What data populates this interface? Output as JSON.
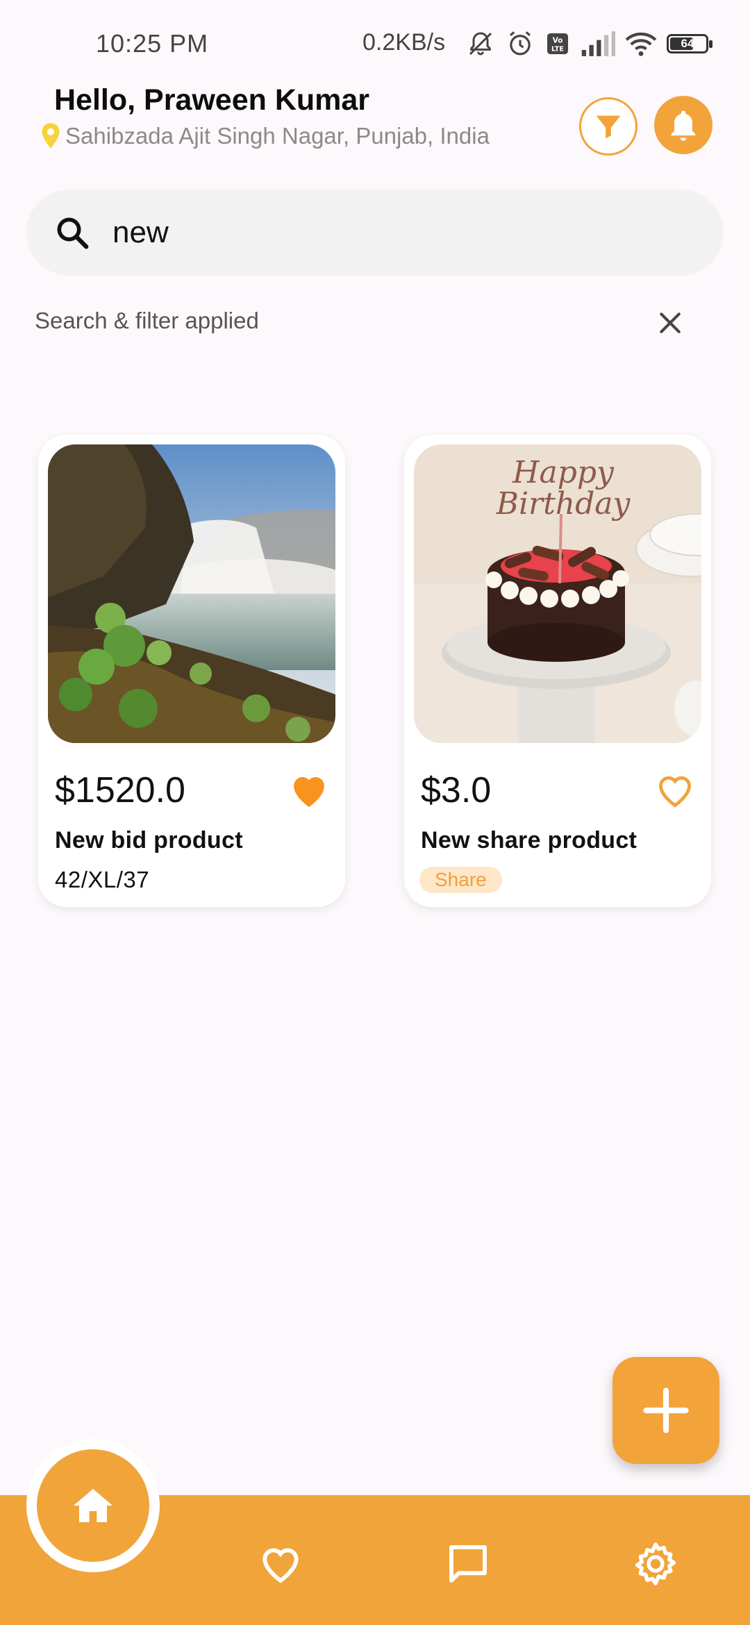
{
  "status_bar": {
    "time": "10:25 PM",
    "network_speed": "0.2KB/s",
    "battery_level": "64",
    "icons": [
      "mute-icon",
      "alarm-icon",
      "volte-icon",
      "signal-icon",
      "wifi-icon",
      "battery-icon"
    ]
  },
  "header": {
    "greeting": "Hello, Praween Kumar",
    "location": "Sahibzada Ajit Singh Nagar, Punjab, India",
    "filter_icon": "filter-icon",
    "notification_icon": "bell-icon"
  },
  "search": {
    "value": "new",
    "filter_status": "Search & filter applied",
    "clear_icon": "close-icon"
  },
  "products": [
    {
      "price": "$1520.0",
      "name": "New bid product",
      "meta": "42/XL/37",
      "favorited": true,
      "image": "waterfall landscape photo"
    },
    {
      "price": "$3.0",
      "name": "New share product",
      "tag": "Share",
      "favorited": false,
      "image": "birthday cake photo",
      "image_text": "Happy Birthday"
    }
  ],
  "fab": {
    "icon": "plus-icon"
  },
  "bottom_nav": {
    "items": [
      {
        "icon": "home-icon",
        "active": true
      },
      {
        "icon": "heart-icon",
        "active": false
      },
      {
        "icon": "chat-icon",
        "active": false
      },
      {
        "icon": "settings-icon",
        "active": false
      }
    ]
  },
  "colors": {
    "accent": "#f2a33a",
    "background": "#fdf8fb",
    "search_bg": "#f1f2f1",
    "tag_bg": "#fde7c8",
    "location_pin": "#f7d23a"
  }
}
